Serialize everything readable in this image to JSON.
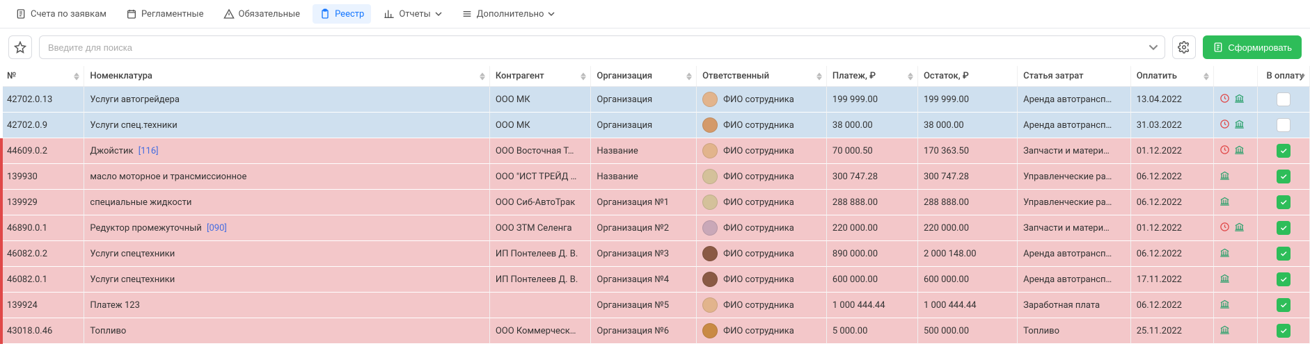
{
  "tabs": {
    "requests": "Счета по заявкам",
    "scheduled": "Регламентные",
    "mandatory": "Обязательные",
    "registry": "Реестр",
    "reports": "Отчеты",
    "extra": "Дополнительно"
  },
  "toolbar": {
    "search_placeholder": "Введите для поиска",
    "generate_label": "Сформировать"
  },
  "columns": {
    "no": "№",
    "nomenclature": "Номенклатура",
    "contractor": "Контрагент",
    "organization": "Организация",
    "responsible": "Ответственный",
    "payment": "Платеж, ₽",
    "remainder": "Остаток, ₽",
    "cost_item": "Статья затрат",
    "pay_date": "Оплатить",
    "to_pay": "В оплату"
  },
  "rows": [
    {
      "no": "42702.0.13",
      "nomenclature": "Услуги автогрейдера",
      "code": "",
      "contractor": "ООО МК",
      "organization": "Организация",
      "responsible": "ФИО сотрудника",
      "avatar": "#e2b48c",
      "payment": "199 999.00",
      "remainder": "199 999.00",
      "cost_item": "Аренда автотрансп…",
      "pay_date": "13.04.2022",
      "clock": true,
      "bank": true,
      "checked": false,
      "tone": "blue",
      "mark": false
    },
    {
      "no": "42702.0.9",
      "nomenclature": "Услуги спец.техники",
      "code": "",
      "contractor": "ООО МК",
      "organization": "Организация",
      "responsible": "ФИО сотрудника",
      "avatar": "#d49a6a",
      "payment": "38 000.00",
      "remainder": "38 000.00",
      "cost_item": "Аренда автотрансп…",
      "pay_date": "31.03.2022",
      "clock": true,
      "bank": true,
      "checked": false,
      "tone": "blue",
      "mark": false
    },
    {
      "no": "44609.0.2",
      "nomenclature": "Джойстик",
      "code": "[116]",
      "contractor": "ООО Восточная Т…",
      "organization": "Название",
      "responsible": "ФИО сотрудника",
      "avatar": "#e2b48c",
      "payment": "70 000.50",
      "remainder": "170 363.50",
      "cost_item": "Запчасти и матери…",
      "pay_date": "01.12.2022",
      "clock": true,
      "bank": true,
      "checked": true,
      "tone": "pink",
      "mark": true
    },
    {
      "no": "139930",
      "nomenclature": "масло моторное и трансмиссионное",
      "code": "",
      "contractor": "ООО \"ИСТ ТРЕЙД …",
      "organization": "Название",
      "responsible": "ФИО сотрудника",
      "avatar": "#d4c19a",
      "payment": "300 747.28",
      "remainder": "300 747.28",
      "cost_item": "Управленческие ра…",
      "pay_date": "06.12.2022",
      "clock": false,
      "bank": true,
      "checked": true,
      "tone": "pink",
      "mark": true
    },
    {
      "no": "139929",
      "nomenclature": "специальные жидкости",
      "code": "",
      "contractor": "ООО Сиб-АвтоТрак",
      "organization": "Организация №1",
      "responsible": "ФИО сотрудника",
      "avatar": "#d4c19a",
      "payment": "288 888.00",
      "remainder": "288 888.00",
      "cost_item": "Управленческие ра…",
      "pay_date": "06.12.2022",
      "clock": false,
      "bank": true,
      "checked": true,
      "tone": "pink",
      "mark": true
    },
    {
      "no": "46890.0.1",
      "nomenclature": "Редуктор промежуточный",
      "code": "[090]",
      "contractor": "ООО ЗТМ Селенга",
      "organization": "Организация №2",
      "responsible": "ФИО сотрудника",
      "avatar": "#c9a8b8",
      "payment": "220 000.00",
      "remainder": "220 000.00",
      "cost_item": "Запчасти и матери…",
      "pay_date": "01.12.2022",
      "clock": true,
      "bank": true,
      "checked": true,
      "tone": "pink",
      "mark": true
    },
    {
      "no": "46082.0.2",
      "nomenclature": "Услуги спецтехники",
      "code": "",
      "contractor": "ИП Понтелеев Д. В.",
      "organization": "Организация №3",
      "responsible": "ФИО сотрудника",
      "avatar": "#8a5a44",
      "payment": "890 000.00",
      "remainder": "2 000 148.00",
      "cost_item": "Аренда автотрансп…",
      "pay_date": "06.12.2022",
      "clock": false,
      "bank": true,
      "checked": true,
      "tone": "pink",
      "mark": true
    },
    {
      "no": "46082.0.1",
      "nomenclature": "Услуги спецтехники",
      "code": "",
      "contractor": "ИП Понтелеев Д. В.",
      "organization": "Организация №4",
      "responsible": "ФИО сотрудника",
      "avatar": "#8a5a44",
      "payment": "600 000.00",
      "remainder": "600 000.00",
      "cost_item": "Аренда автотрансп…",
      "pay_date": "17.11.2022",
      "clock": false,
      "bank": true,
      "checked": true,
      "tone": "pink",
      "mark": true
    },
    {
      "no": "139924",
      "nomenclature": "Платеж 123",
      "code": "",
      "contractor": "",
      "organization": "Организация №5",
      "responsible": "ФИО сотрудника",
      "avatar": "#e2b48c",
      "payment": "1 000 444.44",
      "remainder": "1 000 444.44",
      "cost_item": "Заработная плата",
      "pay_date": "06.12.2022",
      "clock": false,
      "bank": true,
      "checked": true,
      "tone": "pink",
      "mark": true
    },
    {
      "no": "43018.0.46",
      "nomenclature": "Топливо",
      "code": "",
      "contractor": "ООО Коммерческ…",
      "organization": "Организация №6",
      "responsible": "ФИО сотрудника",
      "avatar": "#c98a44",
      "payment": "5 000.00",
      "remainder": "500 000.00",
      "cost_item": "Топливо",
      "pay_date": "25.11.2022",
      "clock": false,
      "bank": true,
      "checked": true,
      "tone": "pink",
      "mark": true
    }
  ]
}
